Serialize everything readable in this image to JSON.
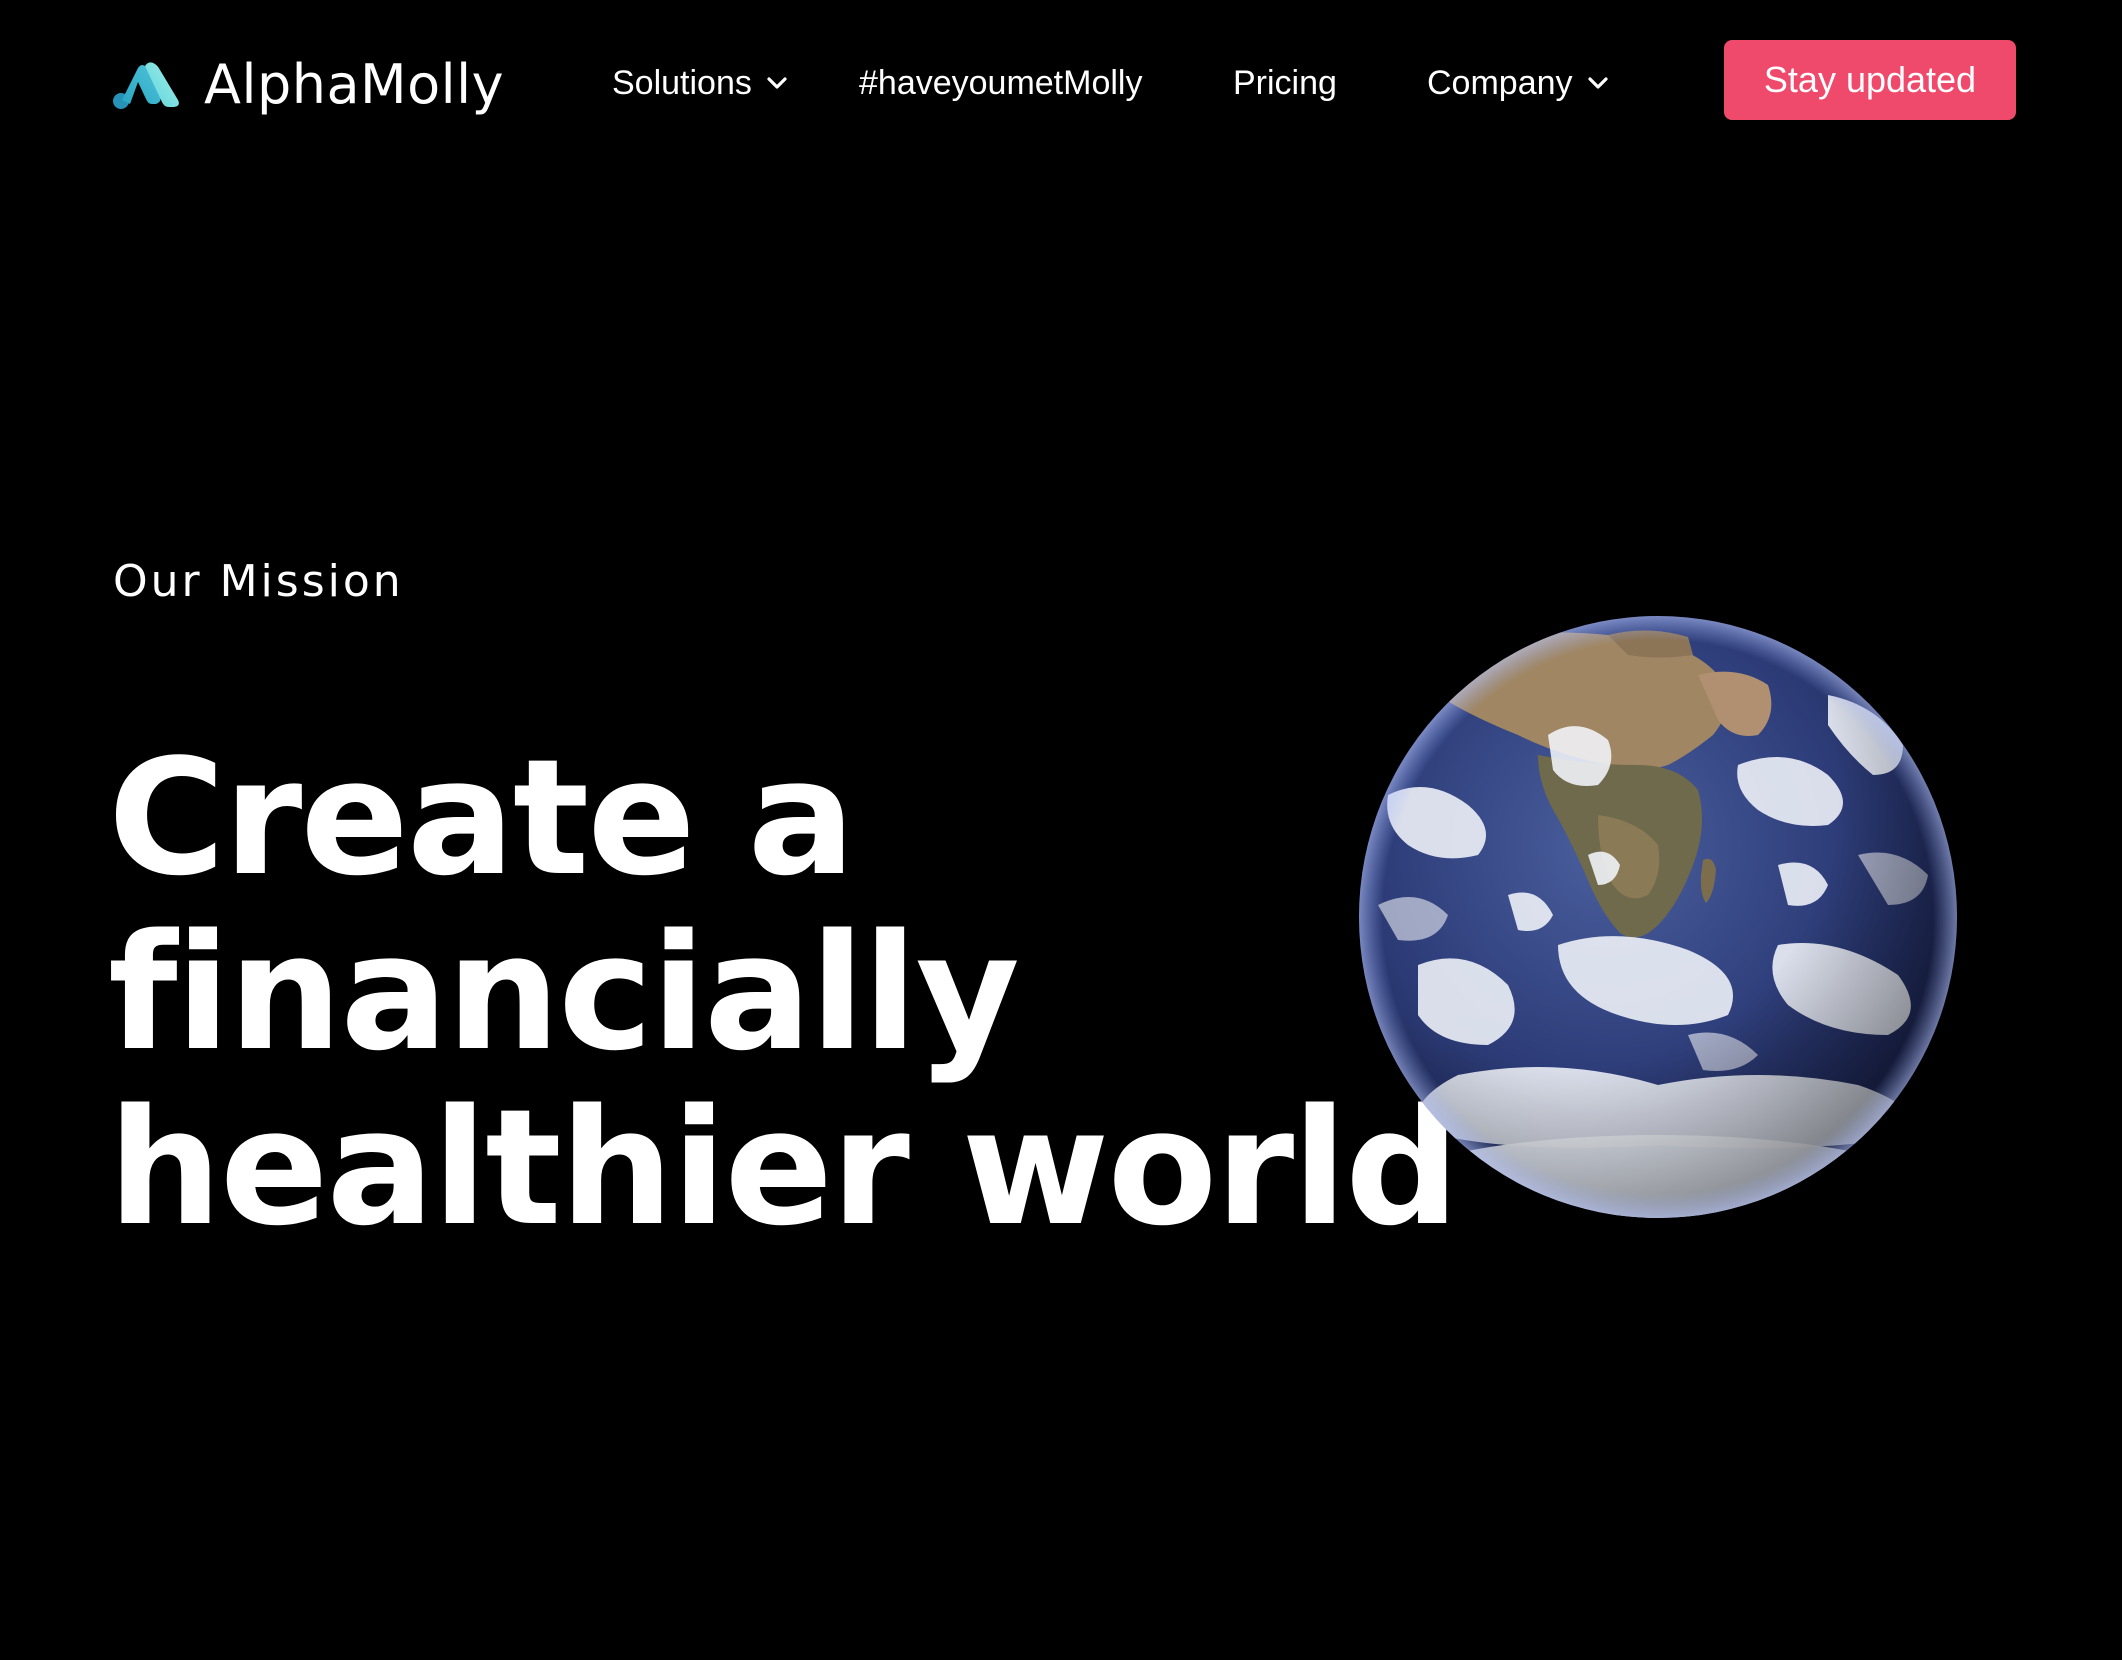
{
  "brand": {
    "name": "AlphaMolly",
    "logo_icon": "alphamolly-logo-icon",
    "colors": {
      "background": "#000000",
      "accent": "#ef4a6c",
      "logo_teal_light": "#7ee0e0",
      "logo_teal_dark": "#2aa6c4"
    }
  },
  "nav": {
    "items": [
      {
        "label": "Solutions",
        "has_dropdown": true
      },
      {
        "label": "#haveyoumetMolly",
        "has_dropdown": false
      },
      {
        "label": "Pricing",
        "has_dropdown": false
      },
      {
        "label": "Company",
        "has_dropdown": true
      }
    ],
    "cta_label": "Stay updated"
  },
  "hero": {
    "eyebrow": "Our Mission",
    "headline_lines": [
      "Create a",
      "financially",
      "healthier world"
    ],
    "image": "earth-globe-image"
  }
}
